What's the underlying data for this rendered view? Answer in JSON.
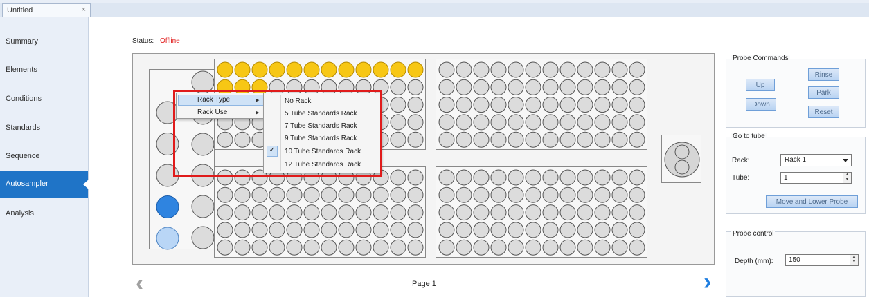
{
  "tabs": [
    {
      "title": "Untitled",
      "close": "×"
    }
  ],
  "sidebar": {
    "items": [
      {
        "label": "Summary"
      },
      {
        "label": "Elements"
      },
      {
        "label": "Conditions"
      },
      {
        "label": "Standards"
      },
      {
        "label": "Sequence"
      },
      {
        "label": "Autosampler",
        "active": true
      },
      {
        "label": "Analysis"
      }
    ]
  },
  "status": {
    "label": "Status:",
    "value": "Offline",
    "value_color": "#e01818"
  },
  "tray": {
    "page_label": "Page 1",
    "prev_icon": "chevron-left-icon",
    "next_icon": "chevron-right-icon"
  },
  "probe_commands": {
    "title": "Probe Commands",
    "up": "Up",
    "down": "Down",
    "rinse": "Rinse",
    "park": "Park",
    "reset": "Reset"
  },
  "go_to_tube": {
    "title": "Go to tube",
    "rack_label": "Rack:",
    "rack_value": "Rack 1",
    "tube_label": "Tube:",
    "tube_value": "1",
    "move_button": "Move and Lower Probe"
  },
  "probe_control": {
    "title": "Probe control",
    "depth_label": "Depth (mm):",
    "depth_value": "150"
  },
  "context_menu": {
    "items": [
      {
        "label": "Rack Type",
        "highlighted": true
      },
      {
        "label": "Rack Use"
      }
    ],
    "submenu": [
      {
        "label": "No Rack",
        "checked": false
      },
      {
        "label": "5 Tube Standards Rack",
        "checked": false
      },
      {
        "label": "7 Tube Standards Rack",
        "checked": false
      },
      {
        "label": "9 Tube Standards Rack",
        "checked": false
      },
      {
        "label": "10 Tube Standards Rack",
        "checked": true
      },
      {
        "label": "12 Tube Standards Rack",
        "checked": false
      }
    ],
    "check_glyph": "✓"
  },
  "colors": {
    "accent": "#1f74c7",
    "highlight": "#e01b1b",
    "filled_tube": "#f7c715",
    "selected_tube": "#2f84e0"
  }
}
